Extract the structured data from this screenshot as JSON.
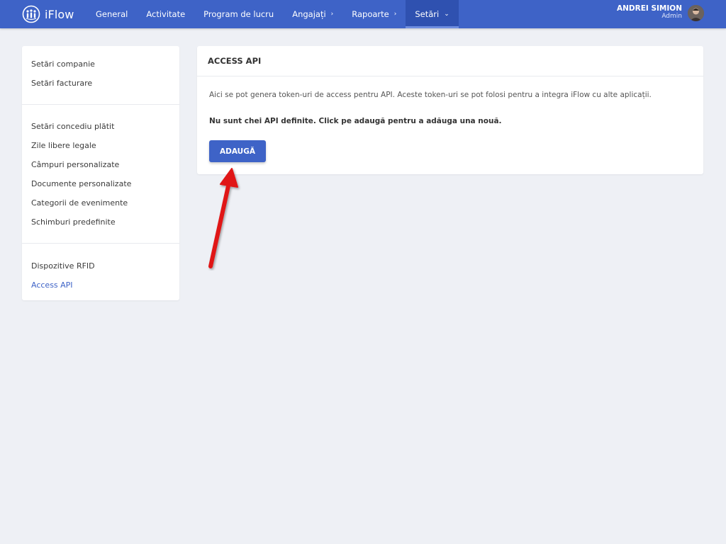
{
  "brand": {
    "name": "iFlow"
  },
  "nav": {
    "items": [
      {
        "label": "General",
        "chevron": ""
      },
      {
        "label": "Activitate",
        "chevron": ""
      },
      {
        "label": "Program de lucru",
        "chevron": ""
      },
      {
        "label": "Angajați",
        "chevron": "›"
      },
      {
        "label": "Rapoarte",
        "chevron": "›"
      },
      {
        "label": "Setări",
        "chevron": "⌄"
      }
    ],
    "active": "Setări"
  },
  "user": {
    "name": "ANDREI SIMION",
    "role": "Admin"
  },
  "sidebar": {
    "groups": [
      {
        "items": [
          {
            "label": "Setări companie"
          },
          {
            "label": "Setări facturare"
          }
        ]
      },
      {
        "items": [
          {
            "label": "Setări concediu plătit"
          },
          {
            "label": "Zile libere legale"
          },
          {
            "label": "Câmpuri personalizate"
          },
          {
            "label": "Documente personalizate"
          },
          {
            "label": "Categorii de evenimente"
          },
          {
            "label": "Schimburi predefinite"
          }
        ]
      },
      {
        "items": [
          {
            "label": "Dispozitive RFID"
          },
          {
            "label": "Access API"
          }
        ]
      }
    ],
    "active": "Access API"
  },
  "card": {
    "title": "ACCESS API",
    "description": "Aici se pot genera token-uri de access pentru API. Aceste token-uri se pot folosi pentru a integra iFlow cu alte aplicații.",
    "notice": "Nu sunt chei API definite. Click pe adaugă pentru a adăuga una nouă.",
    "add_button": "ADAUGĂ"
  },
  "colors": {
    "brand": "#3e63c7",
    "nav_active": "#2f51b0",
    "background": "#eef0f5",
    "annotation_arrow": "#e01818"
  },
  "icons": {
    "logo": "iflow-people-logo-icon",
    "avatar": "user-avatar",
    "arrow": "annotation-arrow"
  }
}
